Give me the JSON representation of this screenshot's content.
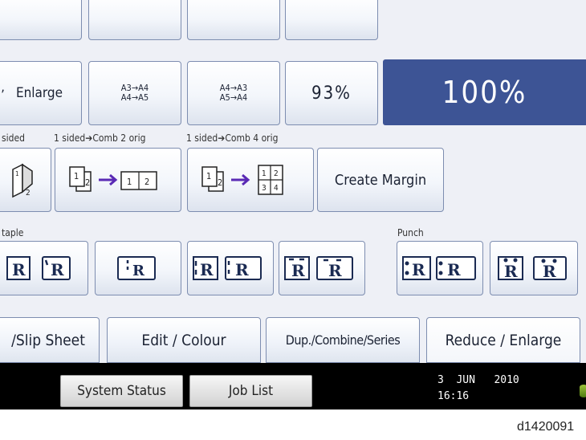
{
  "ratio_row": {
    "enlarge_label": "Enlarge",
    "a3a4_line1": "A3→A4",
    "a3a4_line2": "A4→A5",
    "a4a3_line1": "A4→A3",
    "a4a3_line2": "A5→A4",
    "percent93": "93%",
    "percent100": "100%"
  },
  "combine": {
    "label_sided": "sided",
    "label_comb2": "1 sided➔Comb 2 orig",
    "label_comb4": "1 sided➔Comb 4 orig",
    "icon_num": "2",
    "create_margin": "Create Margin"
  },
  "staple": {
    "label": "taple"
  },
  "punch": {
    "label": "Punch"
  },
  "tabs": {
    "slip_sheet": "/Slip Sheet",
    "edit_colour": "Edit / Colour",
    "dup_combine": "Dup./Combine/Series",
    "reduce_enlarge": "Reduce / Enlarge"
  },
  "bottom": {
    "system_status": "System Status",
    "job_list": "Job List",
    "date": "3  JUN   2010",
    "time": "16:16"
  },
  "figure_id": "d1420091"
}
